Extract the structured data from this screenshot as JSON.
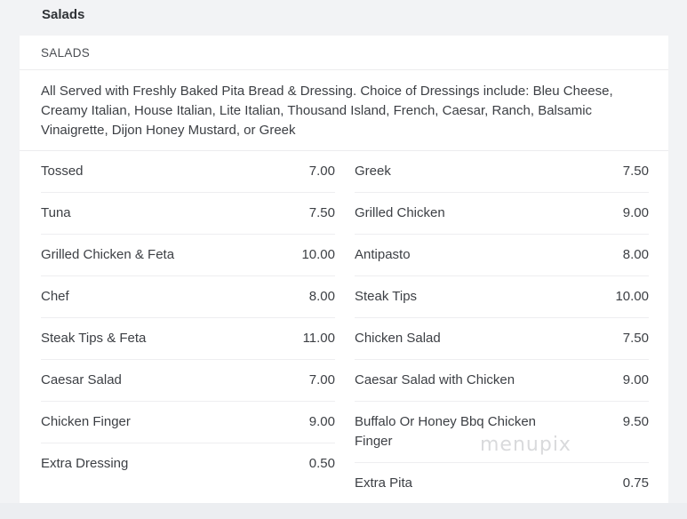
{
  "section": {
    "title": "Salads"
  },
  "card": {
    "subtitle": "SALADS",
    "description": "All Served with Freshly Baked Pita Bread & Dressing. Choice of Dressings include: Bleu Cheese, Creamy Italian, House Italian, Lite Italian, Thousand Island, French, Caesar, Ranch, Balsamic Vinaigrette, Dijon Honey Mustard, or Greek"
  },
  "left_items": [
    {
      "name": "Tossed",
      "price": "7.00"
    },
    {
      "name": "Tuna",
      "price": "7.50"
    },
    {
      "name": "Grilled Chicken & Feta",
      "price": "10.00"
    },
    {
      "name": "Chef",
      "price": "8.00"
    },
    {
      "name": "Steak Tips & Feta",
      "price": "11.00"
    },
    {
      "name": "Caesar Salad",
      "price": "7.00"
    },
    {
      "name": "Chicken Finger",
      "price": "9.00"
    },
    {
      "name": "Extra Dressing",
      "price": "0.50"
    }
  ],
  "right_items": [
    {
      "name": "Greek",
      "price": "7.50"
    },
    {
      "name": "Grilled Chicken",
      "price": "9.00"
    },
    {
      "name": "Antipasto",
      "price": "8.00"
    },
    {
      "name": "Steak Tips",
      "price": "10.00"
    },
    {
      "name": "Chicken Salad",
      "price": "7.50"
    },
    {
      "name": "Caesar Salad with Chicken",
      "price": "9.00"
    },
    {
      "name": "Buffalo Or Honey Bbq Chicken Finger",
      "price": "9.50"
    },
    {
      "name": "Extra Pita",
      "price": "0.75"
    }
  ],
  "watermark": "menupix"
}
